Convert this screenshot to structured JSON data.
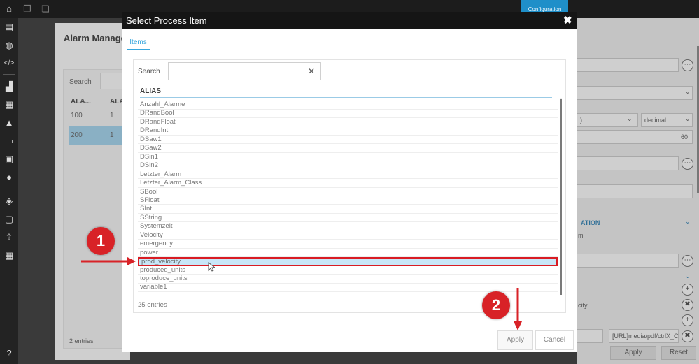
{
  "config_tab": "Configuration",
  "background": {
    "title": "Alarm Manage",
    "search_label": "Search",
    "col1": "ALA...",
    "col2": "ALA",
    "rows": [
      [
        "100",
        "1"
      ],
      [
        "200",
        "1"
      ]
    ],
    "entries": "2 entries"
  },
  "right_panel": {
    "decimal": "decimal",
    "decimal_prefix": ")",
    "value_60": "60",
    "section": "ATION",
    "m_text": "m",
    "city_text": "city",
    "url_field": "[URL]media/pdf/ctrlX_C",
    "apply": "Apply",
    "reset": "Reset"
  },
  "dialog": {
    "title": "Select Process Item",
    "close_glyph": "✖",
    "tab": "Items",
    "search_label": "Search",
    "search_value": "",
    "clear_glyph": "✕",
    "column": "ALIAS",
    "items": [
      "Anzahl_Alarme",
      "DRandBool",
      "DRandFloat",
      "DRandInt",
      "DSaw1",
      "DSaw2",
      "DSin1",
      "DSin2",
      "Letzter_Alarm",
      "Letzter_Alarm_Class",
      "SBool",
      "SFloat",
      "SInt",
      "SString",
      "Systemzeit",
      "Velocity",
      "emergency",
      "power",
      "prod_velocity",
      "produced_units",
      "toproduce_units",
      "variable1"
    ],
    "selected_index": 18,
    "entries": "25 entries",
    "apply": "Apply",
    "cancel": "Cancel"
  },
  "annotations": {
    "badge1": "1",
    "badge2": "2",
    "color": "#d82227"
  }
}
